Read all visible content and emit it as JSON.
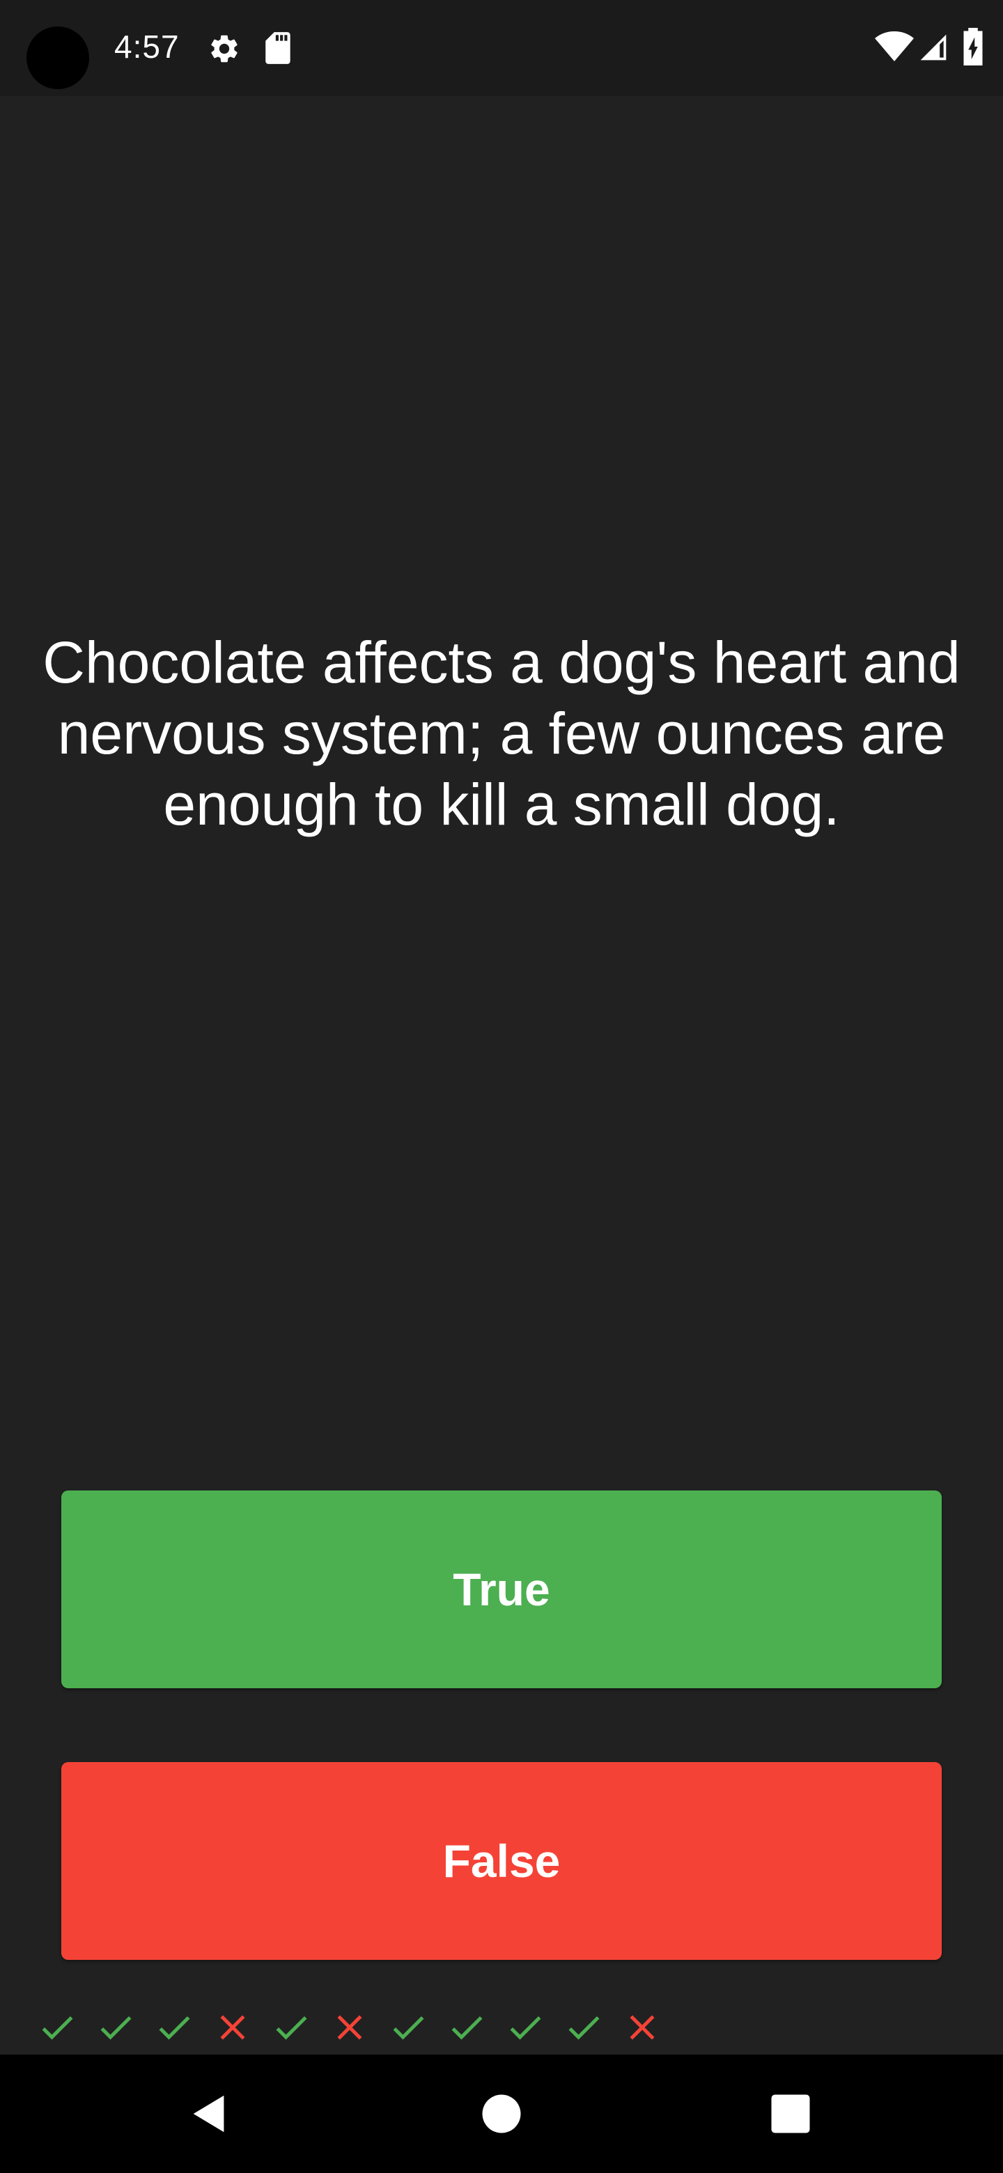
{
  "status_bar": {
    "time": "4:57",
    "icons": [
      "settings-icon",
      "sd-card-icon",
      "wifi-icon",
      "signal-icon",
      "battery-charging-icon"
    ]
  },
  "quiz": {
    "question": "Chocolate affects a dog's heart and nervous system; a few ounces are enough to kill a small dog.",
    "true_label": "True",
    "false_label": "False"
  },
  "score": {
    "marks": [
      "correct",
      "correct",
      "correct",
      "wrong",
      "correct",
      "wrong",
      "correct",
      "correct",
      "correct",
      "correct",
      "wrong"
    ]
  },
  "colors": {
    "background": "#212121",
    "true_button": "#4caf50",
    "false_button": "#f44336",
    "correct_mark": "#4caf50",
    "wrong_mark": "#f44336"
  },
  "nav_bar": {
    "icons": [
      "back-icon",
      "home-icon",
      "recents-icon"
    ]
  }
}
